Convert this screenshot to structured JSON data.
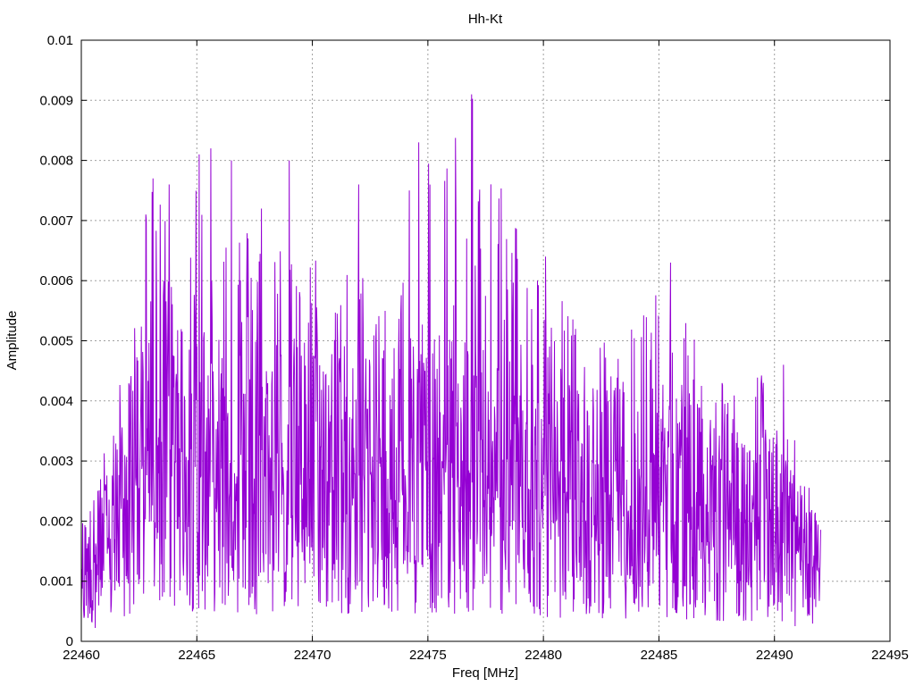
{
  "chart_data": {
    "type": "line",
    "title": "Hh-Kt",
    "xlabel": "Freq [MHz]",
    "ylabel": "Amplitude",
    "xlim": [
      22460,
      22495
    ],
    "ylim": [
      0,
      0.01
    ],
    "xticks": [
      "22460",
      "22465",
      "22470",
      "22475",
      "22480",
      "22485",
      "22490",
      "22495"
    ],
    "yticks": [
      "0",
      "0.001",
      "0.002",
      "0.003",
      "0.004",
      "0.005",
      "0.006",
      "0.007",
      "0.008",
      "0.009",
      "0.01"
    ],
    "grid": true,
    "series_color": "#9400d3",
    "series": [
      {
        "x_start": 22460,
        "x_end": 22492,
        "peaks": [
          {
            "x": 22462.8,
            "y": 0.0071
          },
          {
            "x": 22463.1,
            "y": 0.0077
          },
          {
            "x": 22463.8,
            "y": 0.0076
          },
          {
            "x": 22465.1,
            "y": 0.0081
          },
          {
            "x": 22465.6,
            "y": 0.0082
          },
          {
            "x": 22466.5,
            "y": 0.008
          },
          {
            "x": 22467.8,
            "y": 0.0072
          },
          {
            "x": 22469.0,
            "y": 0.008
          },
          {
            "x": 22472.0,
            "y": 0.0076
          },
          {
            "x": 22474.2,
            "y": 0.0075
          },
          {
            "x": 22474.6,
            "y": 0.0083
          },
          {
            "x": 22476.9,
            "y": 0.0091
          },
          {
            "x": 22480.1,
            "y": 0.0064
          },
          {
            "x": 22485.5,
            "y": 0.0063
          },
          {
            "x": 22490.4,
            "y": 0.0046
          }
        ],
        "envelope": [
          {
            "x": 22460,
            "typical": 0.0012,
            "max": 0.0019
          },
          {
            "x": 22461,
            "typical": 0.0016,
            "max": 0.0032
          },
          {
            "x": 22462,
            "typical": 0.0025,
            "max": 0.005
          },
          {
            "x": 22463,
            "typical": 0.0035,
            "max": 0.0075
          },
          {
            "x": 22465,
            "typical": 0.0032,
            "max": 0.0081
          },
          {
            "x": 22467,
            "typical": 0.003,
            "max": 0.007
          },
          {
            "x": 22470,
            "typical": 0.003,
            "max": 0.0065
          },
          {
            "x": 22473,
            "typical": 0.003,
            "max": 0.006
          },
          {
            "x": 22475,
            "typical": 0.003,
            "max": 0.0083
          },
          {
            "x": 22477,
            "typical": 0.003,
            "max": 0.0091
          },
          {
            "x": 22480,
            "typical": 0.0025,
            "max": 0.006
          },
          {
            "x": 22483,
            "typical": 0.0025,
            "max": 0.005
          },
          {
            "x": 22485,
            "typical": 0.0025,
            "max": 0.006
          },
          {
            "x": 22488,
            "typical": 0.0022,
            "max": 0.0045
          },
          {
            "x": 22490,
            "typical": 0.002,
            "max": 0.0045
          },
          {
            "x": 22492,
            "typical": 0.0012,
            "max": 0.002
          }
        ]
      }
    ]
  }
}
